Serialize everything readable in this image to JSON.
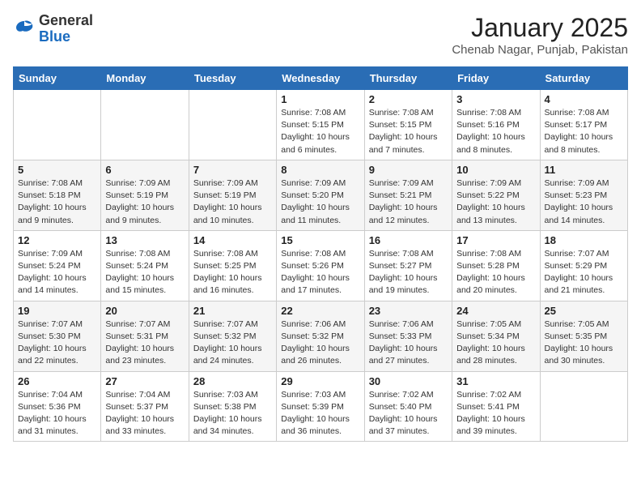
{
  "header": {
    "logo_general": "General",
    "logo_blue": "Blue",
    "month_title": "January 2025",
    "location": "Chenab Nagar, Punjab, Pakistan"
  },
  "weekdays": [
    "Sunday",
    "Monday",
    "Tuesday",
    "Wednesday",
    "Thursday",
    "Friday",
    "Saturday"
  ],
  "weeks": [
    [
      {
        "day": "",
        "info": ""
      },
      {
        "day": "",
        "info": ""
      },
      {
        "day": "",
        "info": ""
      },
      {
        "day": "1",
        "info": "Sunrise: 7:08 AM\nSunset: 5:15 PM\nDaylight: 10 hours\nand 6 minutes."
      },
      {
        "day": "2",
        "info": "Sunrise: 7:08 AM\nSunset: 5:15 PM\nDaylight: 10 hours\nand 7 minutes."
      },
      {
        "day": "3",
        "info": "Sunrise: 7:08 AM\nSunset: 5:16 PM\nDaylight: 10 hours\nand 8 minutes."
      },
      {
        "day": "4",
        "info": "Sunrise: 7:08 AM\nSunset: 5:17 PM\nDaylight: 10 hours\nand 8 minutes."
      }
    ],
    [
      {
        "day": "5",
        "info": "Sunrise: 7:08 AM\nSunset: 5:18 PM\nDaylight: 10 hours\nand 9 minutes."
      },
      {
        "day": "6",
        "info": "Sunrise: 7:09 AM\nSunset: 5:19 PM\nDaylight: 10 hours\nand 9 minutes."
      },
      {
        "day": "7",
        "info": "Sunrise: 7:09 AM\nSunset: 5:19 PM\nDaylight: 10 hours\nand 10 minutes."
      },
      {
        "day": "8",
        "info": "Sunrise: 7:09 AM\nSunset: 5:20 PM\nDaylight: 10 hours\nand 11 minutes."
      },
      {
        "day": "9",
        "info": "Sunrise: 7:09 AM\nSunset: 5:21 PM\nDaylight: 10 hours\nand 12 minutes."
      },
      {
        "day": "10",
        "info": "Sunrise: 7:09 AM\nSunset: 5:22 PM\nDaylight: 10 hours\nand 13 minutes."
      },
      {
        "day": "11",
        "info": "Sunrise: 7:09 AM\nSunset: 5:23 PM\nDaylight: 10 hours\nand 14 minutes."
      }
    ],
    [
      {
        "day": "12",
        "info": "Sunrise: 7:09 AM\nSunset: 5:24 PM\nDaylight: 10 hours\nand 14 minutes."
      },
      {
        "day": "13",
        "info": "Sunrise: 7:08 AM\nSunset: 5:24 PM\nDaylight: 10 hours\nand 15 minutes."
      },
      {
        "day": "14",
        "info": "Sunrise: 7:08 AM\nSunset: 5:25 PM\nDaylight: 10 hours\nand 16 minutes."
      },
      {
        "day": "15",
        "info": "Sunrise: 7:08 AM\nSunset: 5:26 PM\nDaylight: 10 hours\nand 17 minutes."
      },
      {
        "day": "16",
        "info": "Sunrise: 7:08 AM\nSunset: 5:27 PM\nDaylight: 10 hours\nand 19 minutes."
      },
      {
        "day": "17",
        "info": "Sunrise: 7:08 AM\nSunset: 5:28 PM\nDaylight: 10 hours\nand 20 minutes."
      },
      {
        "day": "18",
        "info": "Sunrise: 7:07 AM\nSunset: 5:29 PM\nDaylight: 10 hours\nand 21 minutes."
      }
    ],
    [
      {
        "day": "19",
        "info": "Sunrise: 7:07 AM\nSunset: 5:30 PM\nDaylight: 10 hours\nand 22 minutes."
      },
      {
        "day": "20",
        "info": "Sunrise: 7:07 AM\nSunset: 5:31 PM\nDaylight: 10 hours\nand 23 minutes."
      },
      {
        "day": "21",
        "info": "Sunrise: 7:07 AM\nSunset: 5:32 PM\nDaylight: 10 hours\nand 24 minutes."
      },
      {
        "day": "22",
        "info": "Sunrise: 7:06 AM\nSunset: 5:32 PM\nDaylight: 10 hours\nand 26 minutes."
      },
      {
        "day": "23",
        "info": "Sunrise: 7:06 AM\nSunset: 5:33 PM\nDaylight: 10 hours\nand 27 minutes."
      },
      {
        "day": "24",
        "info": "Sunrise: 7:05 AM\nSunset: 5:34 PM\nDaylight: 10 hours\nand 28 minutes."
      },
      {
        "day": "25",
        "info": "Sunrise: 7:05 AM\nSunset: 5:35 PM\nDaylight: 10 hours\nand 30 minutes."
      }
    ],
    [
      {
        "day": "26",
        "info": "Sunrise: 7:04 AM\nSunset: 5:36 PM\nDaylight: 10 hours\nand 31 minutes."
      },
      {
        "day": "27",
        "info": "Sunrise: 7:04 AM\nSunset: 5:37 PM\nDaylight: 10 hours\nand 33 minutes."
      },
      {
        "day": "28",
        "info": "Sunrise: 7:03 AM\nSunset: 5:38 PM\nDaylight: 10 hours\nand 34 minutes."
      },
      {
        "day": "29",
        "info": "Sunrise: 7:03 AM\nSunset: 5:39 PM\nDaylight: 10 hours\nand 36 minutes."
      },
      {
        "day": "30",
        "info": "Sunrise: 7:02 AM\nSunset: 5:40 PM\nDaylight: 10 hours\nand 37 minutes."
      },
      {
        "day": "31",
        "info": "Sunrise: 7:02 AM\nSunset: 5:41 PM\nDaylight: 10 hours\nand 39 minutes."
      },
      {
        "day": "",
        "info": ""
      }
    ]
  ]
}
